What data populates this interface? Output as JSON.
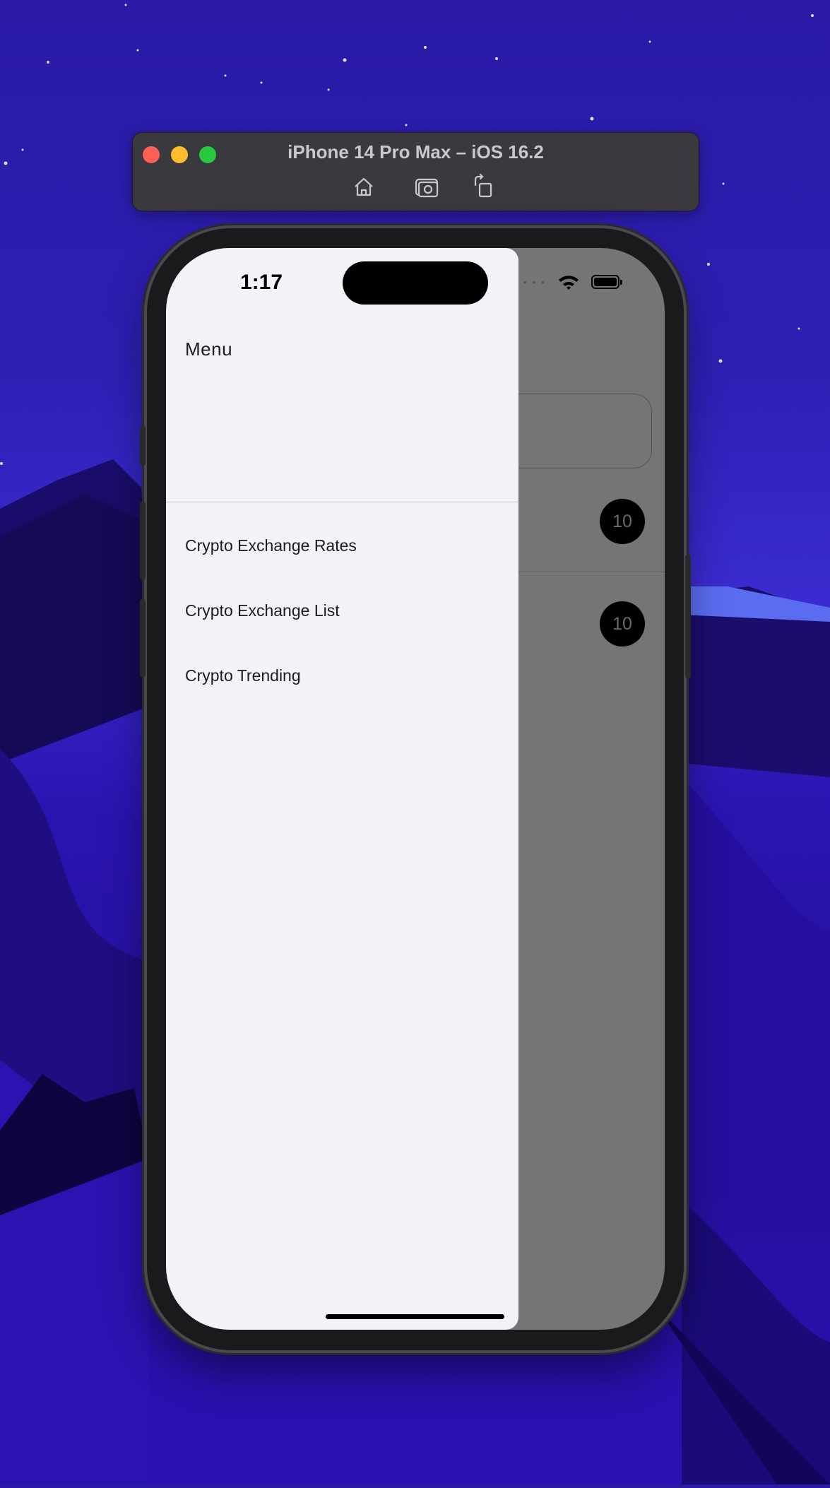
{
  "simulator": {
    "title": "iPhone 14 Pro Max – iOS 16.2",
    "buttons": [
      "home-icon",
      "screenshot-icon",
      "rotate-icon"
    ]
  },
  "status_bar": {
    "time": "1:17"
  },
  "drawer": {
    "header_title": "Menu",
    "items": [
      {
        "label": "Crypto Exchange Rates"
      },
      {
        "label": "Crypto Exchange List"
      },
      {
        "label": "Crypto Trending"
      }
    ]
  },
  "background_app": {
    "badges": [
      "10",
      "10"
    ]
  },
  "colors": {
    "drawer_bg": "#f5f1f8",
    "scrim": "#757477",
    "badge_bg": "#000000",
    "wallpaper": "#2e1fb4"
  }
}
